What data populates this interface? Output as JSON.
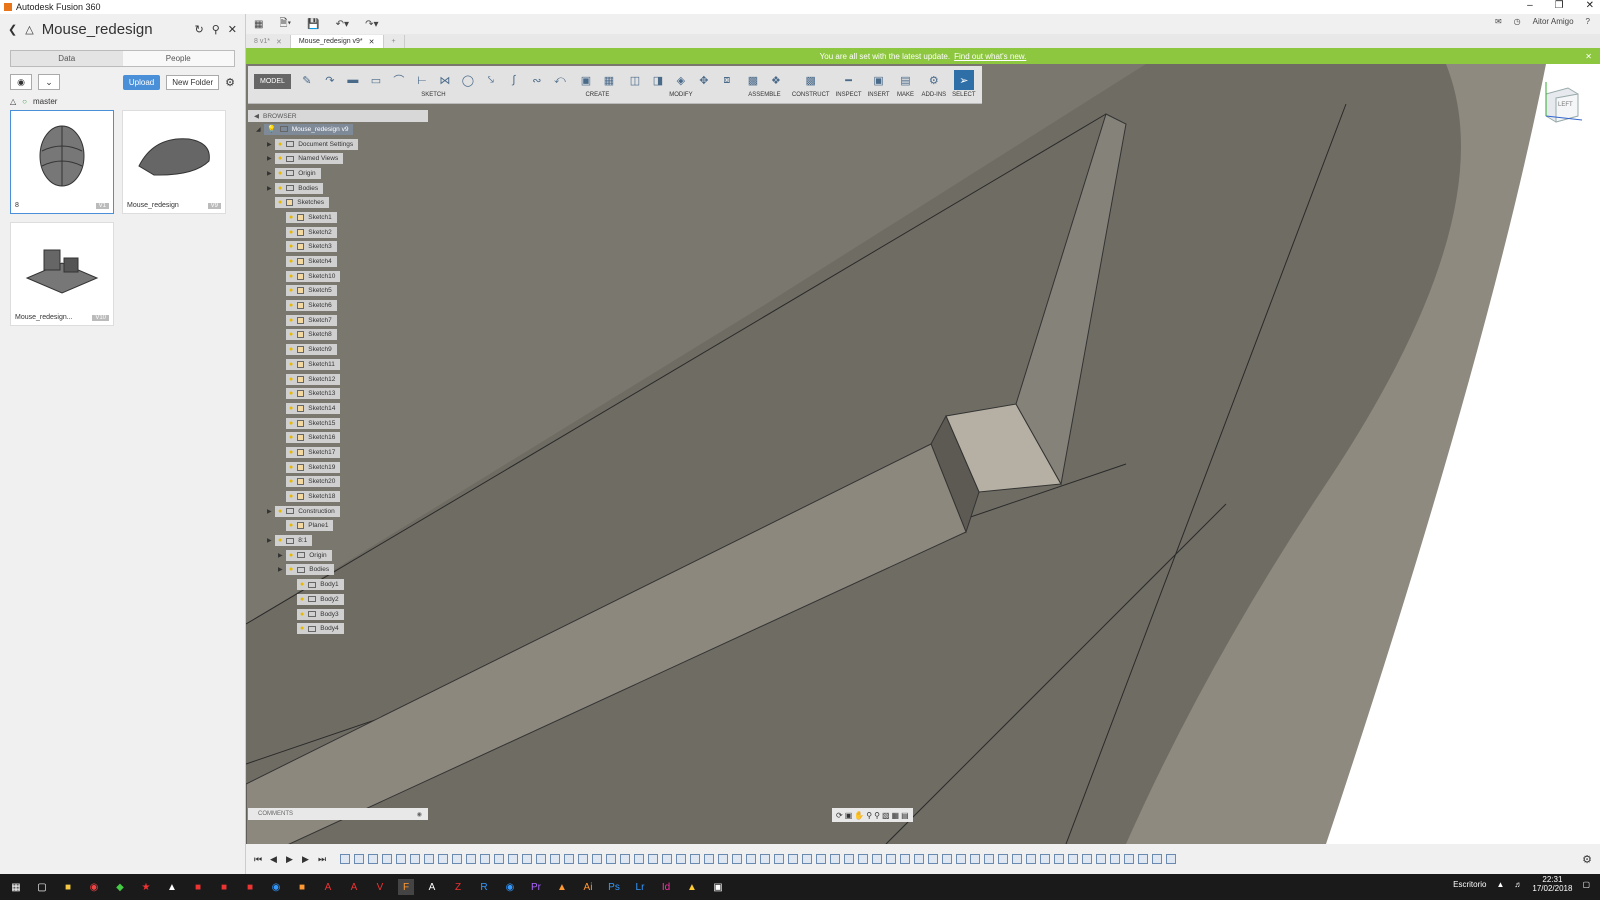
{
  "window": {
    "title": "Autodesk Fusion 360"
  },
  "left_panel": {
    "title": "Mouse_redesign",
    "tabs": [
      "Data",
      "People"
    ],
    "upload_label": "Upload",
    "new_folder_label": "New Folder",
    "branch": "master",
    "cards": [
      {
        "label": "8",
        "version": "V1"
      },
      {
        "label": "Mouse_redesign",
        "version": "V9"
      },
      {
        "label": "Mouse_redesign...",
        "version": "V10"
      }
    ]
  },
  "topbar": {
    "user": "Aitor Amigo"
  },
  "doc_tabs": [
    {
      "label": "8 v1*"
    },
    {
      "label": "Mouse_redesign v9*"
    }
  ],
  "banner": {
    "text": "You are all set with the latest update.",
    "link": "Find out what's new."
  },
  "toolbar": {
    "workspace": "MODEL",
    "groups": [
      "SKETCH",
      "CREATE",
      "MODIFY",
      "ASSEMBLE",
      "CONSTRUCT",
      "INSPECT",
      "INSERT",
      "MAKE",
      "ADD-INS",
      "SELECT"
    ]
  },
  "browser": {
    "header": "BROWSER",
    "root": "Mouse_redesign v9",
    "items": [
      {
        "label": "Document Settings",
        "indent": 1
      },
      {
        "label": "Named Views",
        "indent": 1
      },
      {
        "label": "Origin",
        "indent": 1
      },
      {
        "label": "Bodies",
        "indent": 1
      },
      {
        "label": "Sketches",
        "indent": 1
      },
      {
        "label": "Sketch1",
        "indent": 2
      },
      {
        "label": "Sketch2",
        "indent": 2
      },
      {
        "label": "Sketch3",
        "indent": 2
      },
      {
        "label": "Sketch4",
        "indent": 2
      },
      {
        "label": "Sketch10",
        "indent": 2
      },
      {
        "label": "Sketch5",
        "indent": 2
      },
      {
        "label": "Sketch6",
        "indent": 2
      },
      {
        "label": "Sketch7",
        "indent": 2
      },
      {
        "label": "Sketch8",
        "indent": 2
      },
      {
        "label": "Sketch9",
        "indent": 2
      },
      {
        "label": "Sketch11",
        "indent": 2
      },
      {
        "label": "Sketch12",
        "indent": 2
      },
      {
        "label": "Sketch13",
        "indent": 2
      },
      {
        "label": "Sketch14",
        "indent": 2
      },
      {
        "label": "Sketch15",
        "indent": 2
      },
      {
        "label": "Sketch16",
        "indent": 2
      },
      {
        "label": "Sketch17",
        "indent": 2
      },
      {
        "label": "Sketch19",
        "indent": 2
      },
      {
        "label": "Sketch20",
        "indent": 2
      },
      {
        "label": "Sketch18",
        "indent": 2
      },
      {
        "label": "Construction",
        "indent": 1
      },
      {
        "label": "Plane1",
        "indent": 2
      },
      {
        "label": "8:1",
        "indent": 1
      },
      {
        "label": "Origin",
        "indent": 2
      },
      {
        "label": "Bodies",
        "indent": 2
      },
      {
        "label": "Body1",
        "indent": 3
      },
      {
        "label": "Body2",
        "indent": 3
      },
      {
        "label": "Body3",
        "indent": 3
      },
      {
        "label": "Body4",
        "indent": 3
      }
    ]
  },
  "viewcube": {
    "face": "LEFT"
  },
  "comments": {
    "label": "COMMENTS"
  },
  "taskbar": {
    "desktop_label": "Escritorio",
    "time": "22:31",
    "date": "17/02/2018"
  }
}
